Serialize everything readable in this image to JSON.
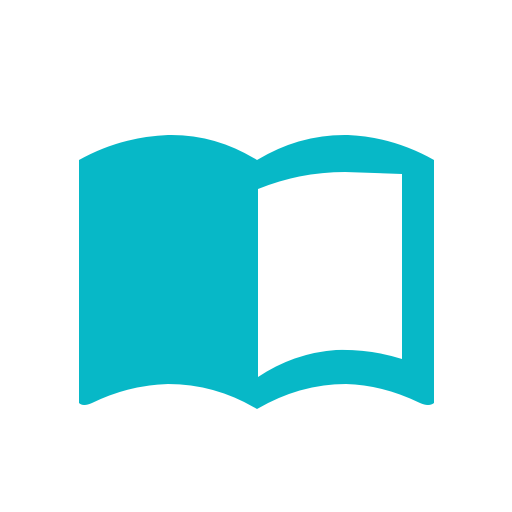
{
  "icon": {
    "name": "open-book-icon",
    "color": "#07b8c7",
    "background": "#ffffff"
  }
}
